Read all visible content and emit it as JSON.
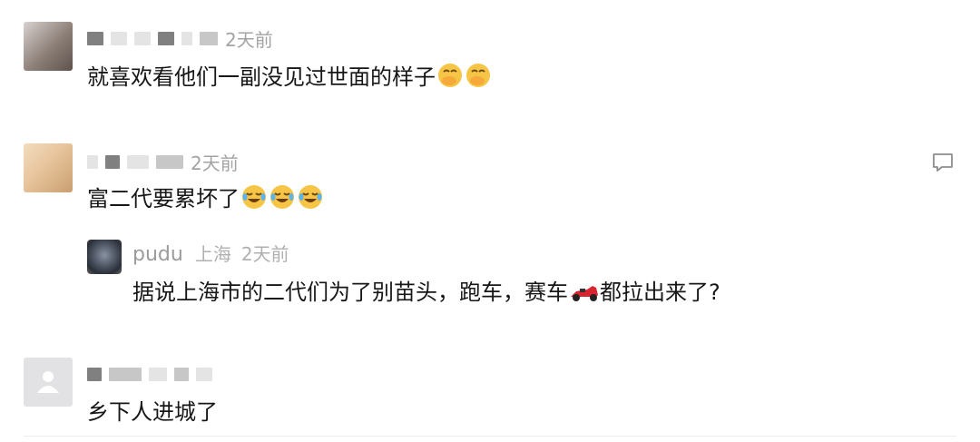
{
  "comments": [
    {
      "time": "2天前",
      "text": "就喜欢看他们一副没见过世面的样子",
      "emoji_icons": [
        "hand-over-mouth-emoji",
        "hand-over-mouth-emoji"
      ]
    },
    {
      "time": "2天前",
      "text": "富二代要累坏了",
      "emoji_icons": [
        "tears-of-joy-emoji",
        "tears-of-joy-emoji",
        "tears-of-joy-emoji"
      ],
      "reply": {
        "name": "pudu",
        "location": "上海",
        "time": "2天前",
        "text_before": "据说上海市的二代们为了别苗头，跑车，赛车",
        "emoji_icon": "race-car-emoji",
        "text_after": "都拉出来了?"
      }
    },
    {
      "text": "乡下人进城了"
    }
  ],
  "icons": {
    "reply_button": "comment-bubble-icon",
    "default_avatar": "person-silhouette-icon"
  }
}
